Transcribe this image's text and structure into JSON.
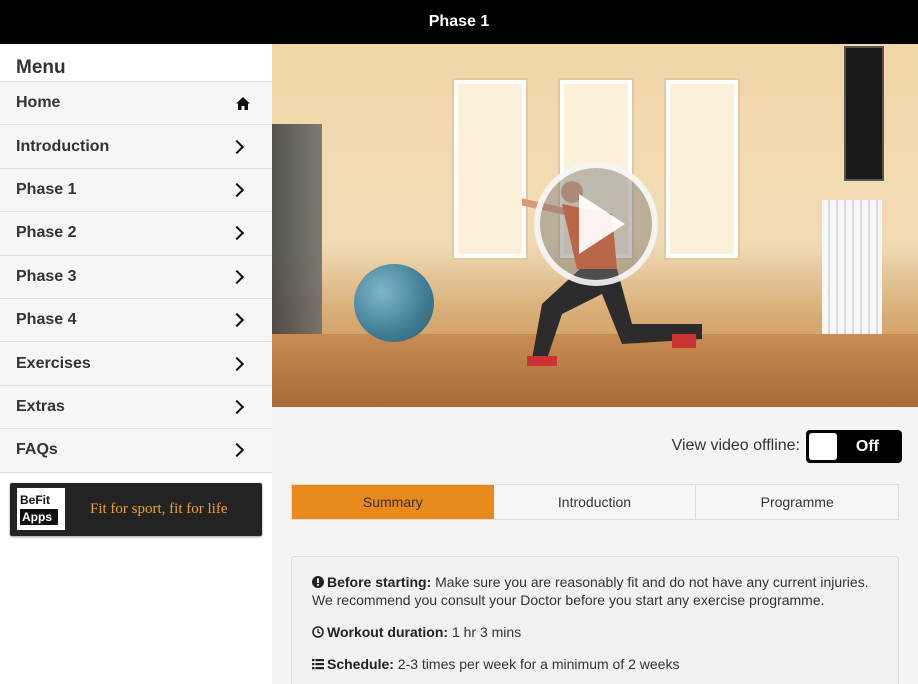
{
  "header": {
    "title": "Phase 1"
  },
  "sidebar": {
    "title": "Menu",
    "items": [
      {
        "label": "Home",
        "icon": "home-icon"
      },
      {
        "label": "Introduction",
        "icon": "chevron-right-icon"
      },
      {
        "label": "Phase 1",
        "icon": "chevron-right-icon"
      },
      {
        "label": "Phase 2",
        "icon": "chevron-right-icon"
      },
      {
        "label": "Phase 3",
        "icon": "chevron-right-icon"
      },
      {
        "label": "Phase 4",
        "icon": "chevron-right-icon"
      },
      {
        "label": "Exercises",
        "icon": "chevron-right-icon"
      },
      {
        "label": "Extras",
        "icon": "chevron-right-icon"
      },
      {
        "label": "FAQs",
        "icon": "chevron-right-icon"
      }
    ],
    "banner": {
      "logo_line1": "BeFit",
      "logo_line2": "Apps",
      "tagline": "Fit for sport, fit for life"
    }
  },
  "video": {
    "play_icon": "play-icon"
  },
  "offline": {
    "label": "View video offline:",
    "state": "Off"
  },
  "tabs": [
    {
      "label": "Summary",
      "active": true
    },
    {
      "label": "Introduction",
      "active": false
    },
    {
      "label": "Programme",
      "active": false
    }
  ],
  "summary": {
    "before_label": "Before starting:",
    "before_text": " Make sure you are reasonably fit and do not have any current injuries. We recommend you consult your Doctor before you start any exercise programme.",
    "duration_label": "Workout duration:",
    "duration_text": " 1 hr 3 mins",
    "schedule_label": "Schedule:",
    "schedule_text": " 2-3 times per week for a minimum of 2 weeks"
  },
  "colors": {
    "accent": "#e88a1a",
    "topbar": "#000000",
    "tagline": "#f0a020"
  }
}
